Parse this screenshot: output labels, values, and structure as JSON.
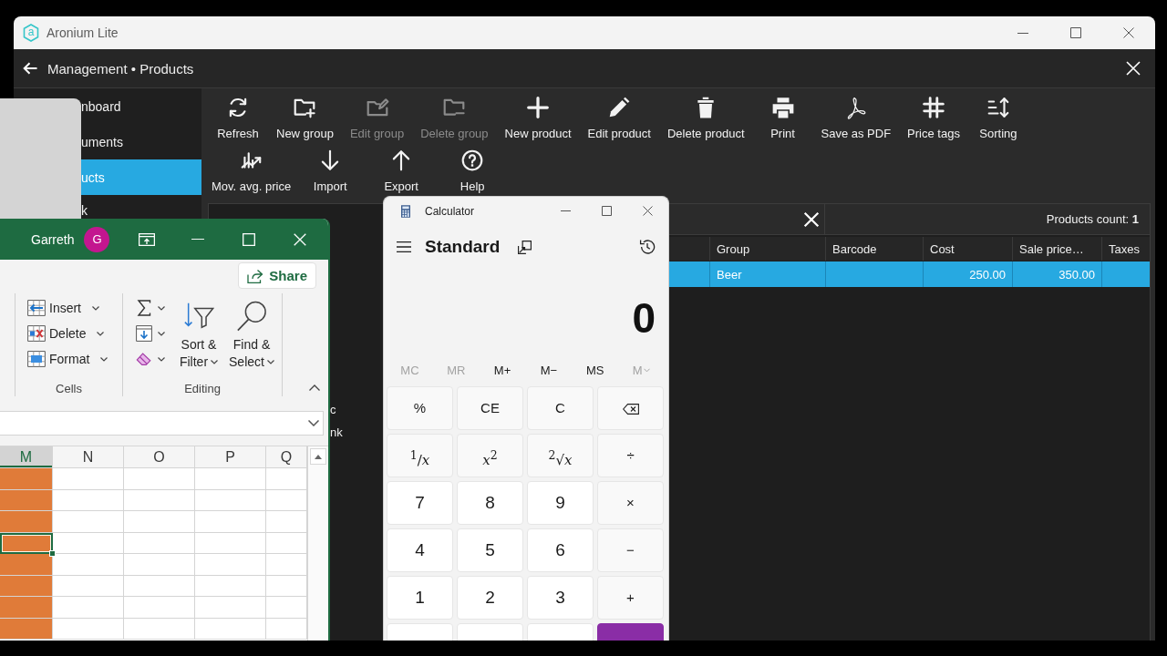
{
  "aronium": {
    "title": "Aronium Lite",
    "logo": "a",
    "breadcrumb": "Management • Products",
    "sidebar": {
      "items": [
        {
          "label": "nboard",
          "selected": false
        },
        {
          "label": "uments",
          "selected": false
        },
        {
          "label": "ucts",
          "selected": true
        },
        {
          "label": "k",
          "selected": false
        }
      ]
    },
    "toolbar": {
      "rows": [
        [
          {
            "label": "Refresh",
            "disabled": false
          },
          {
            "label": "New group",
            "disabled": false
          },
          {
            "label": "Edit group",
            "disabled": true
          },
          {
            "label": "Delete group",
            "disabled": true
          },
          {
            "label": "New product",
            "disabled": false
          },
          {
            "label": "Edit product",
            "disabled": false
          },
          {
            "label": "Delete product",
            "disabled": false
          },
          {
            "label": "Print",
            "disabled": false
          },
          {
            "label": "Save as PDF",
            "disabled": false
          },
          {
            "label": "Price tags",
            "disabled": false
          },
          {
            "label": "Sorting",
            "disabled": false
          }
        ],
        [
          {
            "label": "Mov. avg. price",
            "disabled": false
          },
          {
            "label": "Import",
            "disabled": false
          },
          {
            "label": "Export",
            "disabled": false
          },
          {
            "label": "Help",
            "disabled": false
          }
        ]
      ]
    },
    "groups_tree": {
      "items": [
        "c",
        "nk"
      ]
    },
    "products_count": "Products count: **1**",
    "table": {
      "columns": [
        "Group",
        "Barcode",
        "Cost",
        "Sale price…",
        "Taxes"
      ],
      "rows": [
        {
          "selected": true,
          "cells": [
            "Beer",
            null,
            "250.00",
            "350.00",
            null
          ]
        }
      ]
    }
  },
  "excel": {
    "user": "Garreth",
    "avatar": "G",
    "share": "Share",
    "cells_group": {
      "label": "Cells",
      "commands": [
        "Insert",
        "Delete",
        "Format"
      ]
    },
    "editing_group": {
      "label": "Editing",
      "commands": [
        "Sort & Filter",
        "Find & Select"
      ]
    },
    "grid": {
      "columns": [
        {
          "label": "M",
          "selected": true,
          "color": "#e07b39"
        },
        {
          "label": "N",
          "selected": false
        },
        {
          "label": "O",
          "selected": false
        },
        {
          "label": "P",
          "selected": false
        },
        {
          "label": "Q",
          "selected": false
        }
      ],
      "rows": [
        {
          "selected": false
        },
        {
          "selected": false
        },
        {
          "selected": false
        },
        {
          "selected": true
        },
        {
          "selected": false
        },
        {
          "selected": false
        },
        {
          "selected": false
        },
        {
          "selected": false
        }
      ]
    }
  },
  "calculator": {
    "title": "Calculator",
    "mode": "Standard",
    "display": "0",
    "memory": [
      {
        "label": "MC",
        "disabled": true,
        "kind": "plain"
      },
      {
        "label": "MR",
        "disabled": true,
        "kind": "plain"
      },
      {
        "label": "M+",
        "disabled": false,
        "kind": "plain"
      },
      {
        "label": "M−",
        "disabled": false,
        "kind": "plain"
      },
      {
        "label": "MS",
        "disabled": false,
        "kind": "plain"
      },
      {
        "label": "M",
        "disabled": true,
        "kind": "dropdown"
      }
    ],
    "keys": [
      [
        {
          "label": "%",
          "kind": "function"
        },
        {
          "label": "CE",
          "kind": "function"
        },
        {
          "label": "C",
          "kind": "function"
        },
        {
          "kind": "backspace"
        }
      ],
      [
        {
          "label": "$^{1}$/*x*",
          "kind": "math"
        },
        {
          "label": "*x*$^{2}$",
          "kind": "math"
        },
        {
          "label": "$^{2}$√*x*",
          "kind": "math"
        },
        {
          "label": "÷",
          "kind": "function"
        }
      ],
      [
        {
          "label": "7",
          "kind": "number"
        },
        {
          "label": "8",
          "kind": "number"
        },
        {
          "label": "9",
          "kind": "number"
        },
        {
          "label": "×",
          "kind": "function"
        }
      ],
      [
        {
          "label": "4",
          "kind": "number"
        },
        {
          "label": "5",
          "kind": "number"
        },
        {
          "label": "6",
          "kind": "number"
        },
        {
          "label": "−",
          "kind": "function"
        }
      ],
      [
        {
          "label": "1",
          "kind": "number"
        },
        {
          "label": "2",
          "kind": "number"
        },
        {
          "label": "3",
          "kind": "number"
        },
        {
          "label": "+",
          "kind": "function"
        }
      ],
      [
        {
          "kind": "number"
        },
        {
          "kind": "number"
        },
        {
          "kind": "number"
        },
        {
          "kind": "equals"
        }
      ]
    ]
  }
}
